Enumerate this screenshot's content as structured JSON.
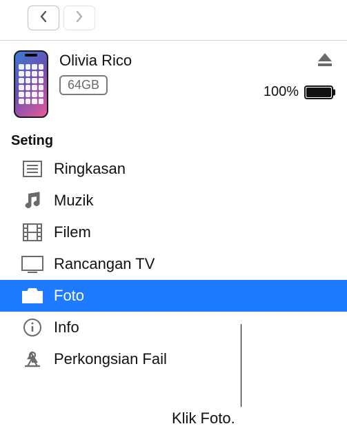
{
  "nav": {
    "back_enabled": true,
    "forward_enabled": false
  },
  "device": {
    "name": "Olivia Rico",
    "storage": "64GB",
    "battery_pct": "100%"
  },
  "section_title": "Seting",
  "sidebar": {
    "items": [
      {
        "label": "Ringkasan",
        "icon": "summary",
        "selected": false
      },
      {
        "label": "Muzik",
        "icon": "music",
        "selected": false
      },
      {
        "label": "Filem",
        "icon": "film",
        "selected": false
      },
      {
        "label": "Rancangan TV",
        "icon": "tv",
        "selected": false
      },
      {
        "label": "Foto",
        "icon": "camera",
        "selected": true
      },
      {
        "label": "Info",
        "icon": "info",
        "selected": false
      },
      {
        "label": "Perkongsian Fail",
        "icon": "filesharing",
        "selected": false
      }
    ]
  },
  "callout": "Klik Foto."
}
